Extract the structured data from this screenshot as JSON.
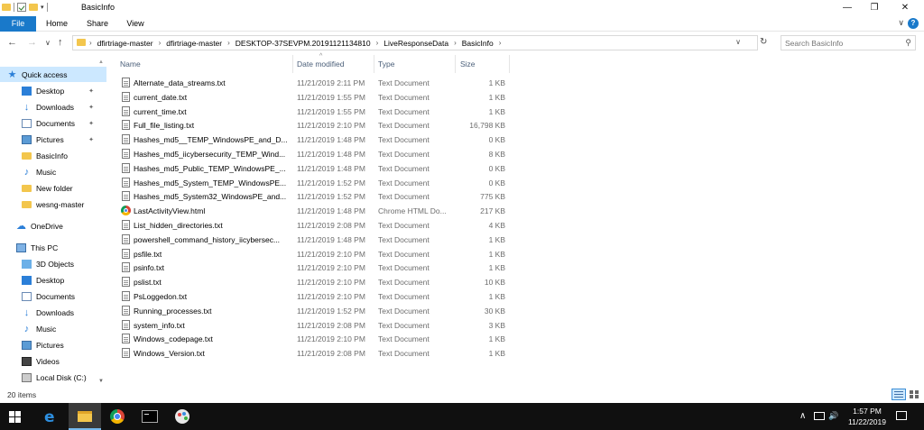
{
  "window": {
    "title": "BasicInfo",
    "minimize_label": "—",
    "maximize_label": "❐",
    "close_label": "✕"
  },
  "ribbon": {
    "tabs": [
      "File",
      "Home",
      "Share",
      "View"
    ],
    "expand_label": "∨",
    "help_label": "?"
  },
  "address": {
    "crumbs": [
      "dfirtriage-master",
      "dfirtriage-master",
      "DESKTOP-37SEVPM.20191121134810",
      "LiveResponseData",
      "BasicInfo"
    ],
    "separator": "›",
    "search_placeholder": "Search BasicInfo"
  },
  "nav": {
    "quick_access": "Quick access",
    "quick_items": [
      "Desktop",
      "Downloads",
      "Documents",
      "Pictures",
      "BasicInfo",
      "Music",
      "New folder",
      "wesng-master"
    ],
    "onedrive": "OneDrive",
    "this_pc": "This PC",
    "pc_items": [
      "3D Objects",
      "Desktop",
      "Documents",
      "Downloads",
      "Music",
      "Pictures",
      "Videos",
      "Local Disk (C:)"
    ]
  },
  "columns": {
    "name": "Name",
    "date": "Date modified",
    "type": "Type",
    "size": "Size"
  },
  "files": [
    {
      "name": "Alternate_data_streams.txt",
      "date": "11/21/2019 2:11 PM",
      "type": "Text Document",
      "size": "1 KB"
    },
    {
      "name": "current_date.txt",
      "date": "11/21/2019 1:55 PM",
      "type": "Text Document",
      "size": "1 KB"
    },
    {
      "name": "current_time.txt",
      "date": "11/21/2019 1:55 PM",
      "type": "Text Document",
      "size": "1 KB"
    },
    {
      "name": "Full_file_listing.txt",
      "date": "11/21/2019 2:10 PM",
      "type": "Text Document",
      "size": "16,798 KB"
    },
    {
      "name": "Hashes_md5__TEMP_WindowsPE_and_D...",
      "date": "11/21/2019 1:48 PM",
      "type": "Text Document",
      "size": "0 KB"
    },
    {
      "name": "Hashes_md5_iicybersecurity_TEMP_Wind...",
      "date": "11/21/2019 1:48 PM",
      "type": "Text Document",
      "size": "8 KB"
    },
    {
      "name": "Hashes_md5_Public_TEMP_WindowsPE_...",
      "date": "11/21/2019 1:48 PM",
      "type": "Text Document",
      "size": "0 KB"
    },
    {
      "name": "Hashes_md5_System_TEMP_WindowsPE...",
      "date": "11/21/2019 1:52 PM",
      "type": "Text Document",
      "size": "0 KB"
    },
    {
      "name": "Hashes_md5_System32_WindowsPE_and...",
      "date": "11/21/2019 1:52 PM",
      "type": "Text Document",
      "size": "775 KB"
    },
    {
      "name": "LastActivityView.html",
      "date": "11/21/2019 1:48 PM",
      "type": "Chrome HTML Do...",
      "size": "217 KB",
      "icon": "chrome-icon"
    },
    {
      "name": "List_hidden_directories.txt",
      "date": "11/21/2019 2:08 PM",
      "type": "Text Document",
      "size": "4 KB"
    },
    {
      "name": "powershell_command_history_iicybersec...",
      "date": "11/21/2019 1:48 PM",
      "type": "Text Document",
      "size": "1 KB"
    },
    {
      "name": "psfile.txt",
      "date": "11/21/2019 2:10 PM",
      "type": "Text Document",
      "size": "1 KB"
    },
    {
      "name": "psinfo.txt",
      "date": "11/21/2019 2:10 PM",
      "type": "Text Document",
      "size": "1 KB"
    },
    {
      "name": "pslist.txt",
      "date": "11/21/2019 2:10 PM",
      "type": "Text Document",
      "size": "10 KB"
    },
    {
      "name": "PsLoggedon.txt",
      "date": "11/21/2019 2:10 PM",
      "type": "Text Document",
      "size": "1 KB"
    },
    {
      "name": "Running_processes.txt",
      "date": "11/21/2019 1:52 PM",
      "type": "Text Document",
      "size": "30 KB"
    },
    {
      "name": "system_info.txt",
      "date": "11/21/2019 2:08 PM",
      "type": "Text Document",
      "size": "3 KB"
    },
    {
      "name": "Windows_codepage.txt",
      "date": "11/21/2019 2:10 PM",
      "type": "Text Document",
      "size": "1 KB"
    },
    {
      "name": "Windows_Version.txt",
      "date": "11/21/2019 2:08 PM",
      "type": "Text Document",
      "size": "1 KB"
    }
  ],
  "status": {
    "item_count": "20 items"
  },
  "taskbar": {
    "time": "1:57 PM",
    "date": "11/22/2019",
    "tray_chevron": "∧",
    "volume_icon": "🔊"
  },
  "colors": {
    "accent": "#1979ca",
    "selection": "#cce8ff",
    "folder": "#f3c64d",
    "taskbar": "#101010"
  }
}
